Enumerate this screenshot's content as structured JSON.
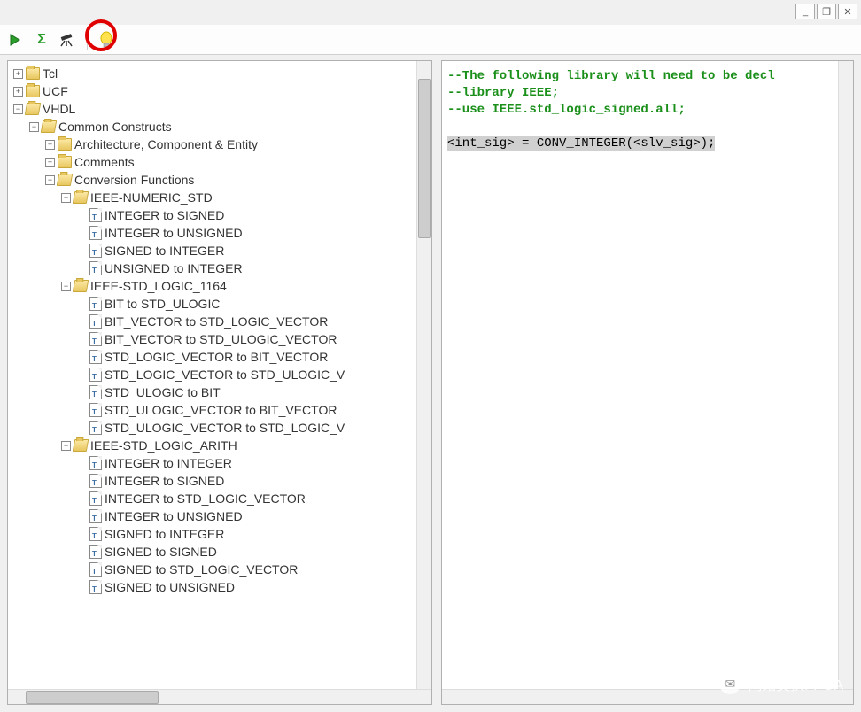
{
  "windowControls": {
    "min": "_",
    "max": "❐",
    "close": "✕"
  },
  "toolbar": {
    "play": "play-icon",
    "sigma": "Σ",
    "telescope": "telescope-icon",
    "bulb": "lightbulb-icon"
  },
  "tree": [
    {
      "label": "Tcl",
      "type": "folder",
      "state": "collapsed",
      "children": []
    },
    {
      "label": "UCF",
      "type": "folder",
      "state": "collapsed",
      "children": []
    },
    {
      "label": "VHDL",
      "type": "folder-open",
      "state": "expanded",
      "children": [
        {
          "label": "Common Constructs",
          "type": "folder-open",
          "state": "expanded",
          "children": [
            {
              "label": "Architecture, Component & Entity",
              "type": "folder",
              "state": "collapsed",
              "children": []
            },
            {
              "label": "Comments",
              "type": "folder",
              "state": "collapsed",
              "children": []
            },
            {
              "label": "Conversion Functions",
              "type": "folder-open",
              "state": "expanded",
              "children": [
                {
                  "label": "IEEE-NUMERIC_STD",
                  "type": "folder-open",
                  "state": "expanded",
                  "children": [
                    {
                      "label": "INTEGER to SIGNED",
                      "type": "file"
                    },
                    {
                      "label": "INTEGER to UNSIGNED",
                      "type": "file"
                    },
                    {
                      "label": "SIGNED to INTEGER",
                      "type": "file"
                    },
                    {
                      "label": "UNSIGNED to INTEGER",
                      "type": "file"
                    }
                  ]
                },
                {
                  "label": "IEEE-STD_LOGIC_1164",
                  "type": "folder-open",
                  "state": "expanded",
                  "children": [
                    {
                      "label": "BIT to STD_ULOGIC",
                      "type": "file"
                    },
                    {
                      "label": "BIT_VECTOR to STD_LOGIC_VECTOR",
                      "type": "file"
                    },
                    {
                      "label": "BIT_VECTOR to STD_ULOGIC_VECTOR",
                      "type": "file"
                    },
                    {
                      "label": "STD_LOGIC_VECTOR to BIT_VECTOR",
                      "type": "file"
                    },
                    {
                      "label": "STD_LOGIC_VECTOR to STD_ULOGIC_V",
                      "type": "file"
                    },
                    {
                      "label": "STD_ULOGIC to BIT",
                      "type": "file"
                    },
                    {
                      "label": "STD_ULOGIC_VECTOR to BIT_VECTOR",
                      "type": "file"
                    },
                    {
                      "label": "STD_ULOGIC_VECTOR to STD_LOGIC_V",
                      "type": "file"
                    }
                  ]
                },
                {
                  "label": "IEEE-STD_LOGIC_ARITH",
                  "type": "folder-open",
                  "state": "expanded",
                  "children": [
                    {
                      "label": "INTEGER to INTEGER",
                      "type": "file"
                    },
                    {
                      "label": "INTEGER to SIGNED",
                      "type": "file"
                    },
                    {
                      "label": "INTEGER to STD_LOGIC_VECTOR",
                      "type": "file"
                    },
                    {
                      "label": "INTEGER to UNSIGNED",
                      "type": "file"
                    },
                    {
                      "label": "SIGNED to INTEGER",
                      "type": "file"
                    },
                    {
                      "label": "SIGNED to SIGNED",
                      "type": "file"
                    },
                    {
                      "label": "SIGNED to STD_LOGIC_VECTOR",
                      "type": "file"
                    },
                    {
                      "label": "SIGNED to UNSIGNED",
                      "type": "file"
                    }
                  ]
                }
              ]
            }
          ]
        }
      ]
    }
  ],
  "code": {
    "comment1": "--The following library will need to be decl",
    "comment2": "--library IEEE;",
    "comment3": "--use IEEE.std_logic_signed.all;",
    "highlight": "<int_sig> = CONV_INTEGER(<slv_sig>);"
  },
  "watermark": "网络交换FPGA"
}
